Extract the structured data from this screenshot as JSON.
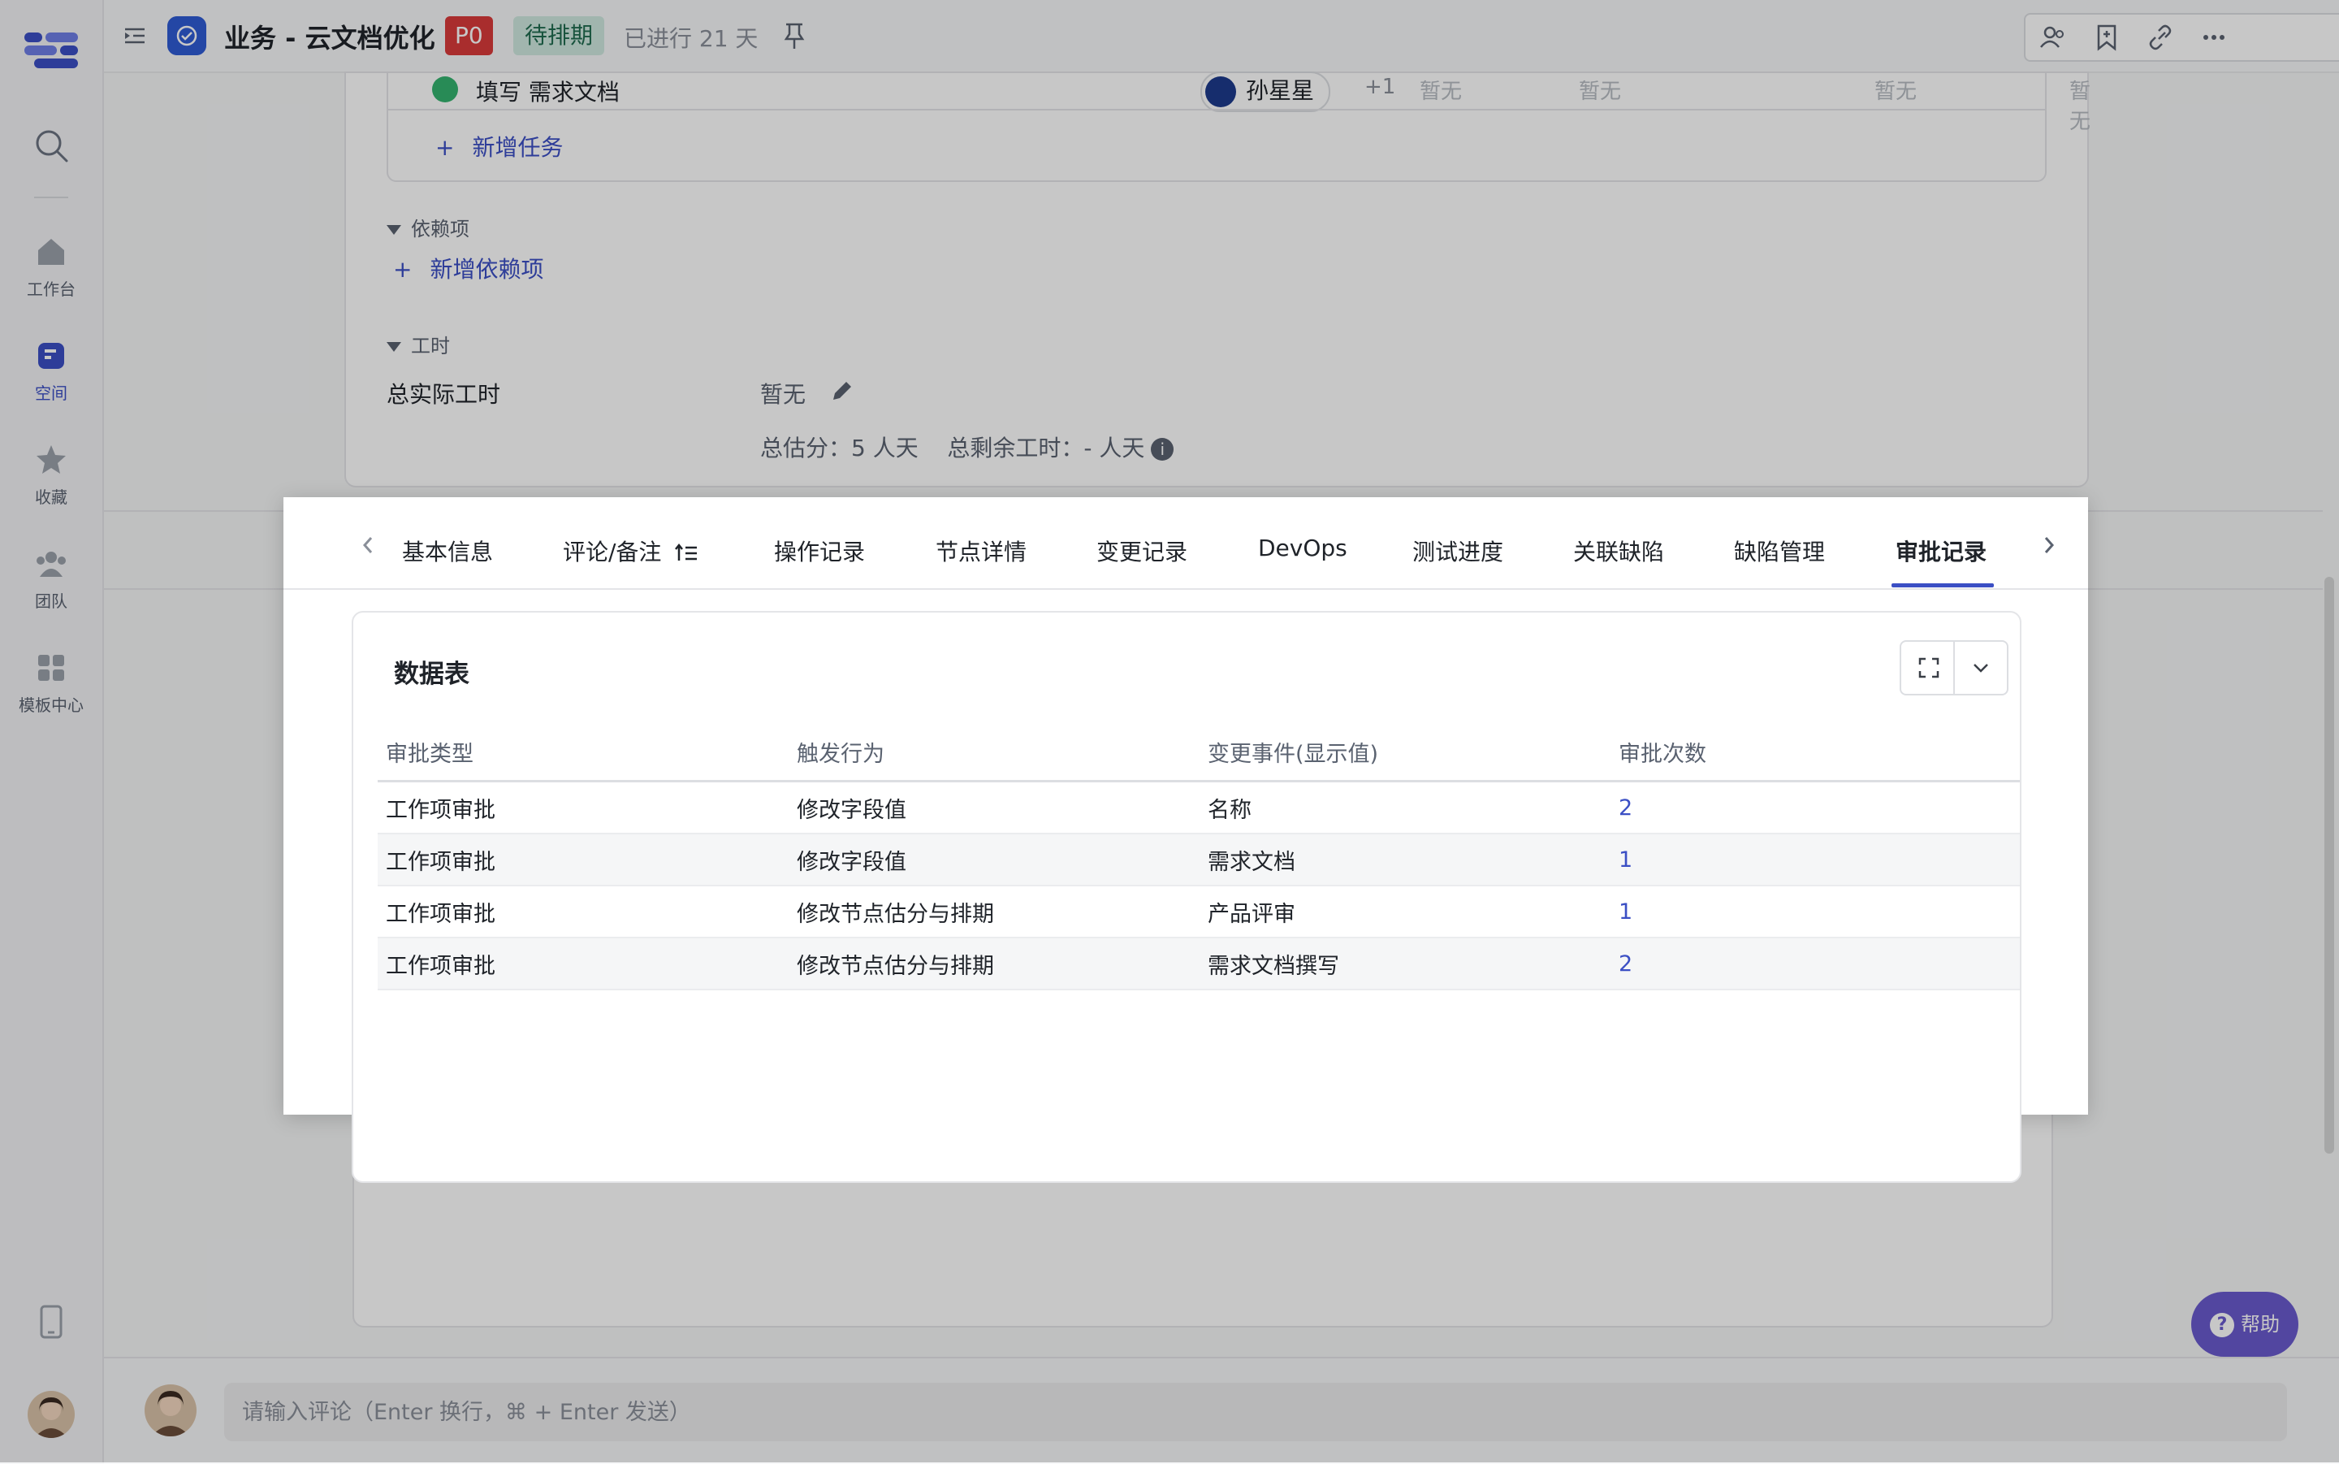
{
  "sidebar": {
    "items": [
      {
        "label": "工作台",
        "icon": "home-icon",
        "active": false
      },
      {
        "label": "空间",
        "icon": "space-icon",
        "active": true
      },
      {
        "label": "收藏",
        "icon": "star-icon",
        "active": false
      },
      {
        "label": "团队",
        "icon": "team-icon",
        "active": false
      },
      {
        "label": "模板中心",
        "icon": "template-icon",
        "active": false
      }
    ]
  },
  "header": {
    "title": "业务 - 云文档优化",
    "priority": "P0",
    "status": "待排期",
    "elapsed": "已进行 21 天"
  },
  "task": {
    "name": "填写 需求文档",
    "owner": "孙星星",
    "extra_owners": "+1",
    "placeholder_value": "暂无",
    "add_task_label": "新增任务"
  },
  "dependencies": {
    "section_label": "依赖项",
    "add_label": "新增依赖项"
  },
  "work_hours": {
    "section_label": "工时",
    "total_label": "总实际工时",
    "total_value": "暂无",
    "summary": "总估分：5 人天    总剩余工时：- 人天"
  },
  "modal": {
    "tabs": [
      {
        "label": "基本信息"
      },
      {
        "label": "评论/备注"
      },
      {
        "label": "操作记录"
      },
      {
        "label": "节点详情"
      },
      {
        "label": "变更记录"
      },
      {
        "label": "DevOps"
      },
      {
        "label": "测试进度"
      },
      {
        "label": "关联缺陷"
      },
      {
        "label": "缺陷管理"
      },
      {
        "label": "审批记录",
        "active": true
      }
    ],
    "panel_title": "数据表",
    "table": {
      "headers": [
        "审批类型",
        "触发行为",
        "变更事件(显示值)",
        "审批次数"
      ],
      "rows": [
        [
          "工作项审批",
          "修改字段值",
          "名称",
          "2"
        ],
        [
          "工作项审批",
          "修改字段值",
          "需求文档",
          "1"
        ],
        [
          "工作项审批",
          "修改节点估分与排期",
          "产品评审",
          "1"
        ],
        [
          "工作项审批",
          "修改节点估分与排期",
          "需求文档撰写",
          "2"
        ]
      ]
    }
  },
  "comment": {
    "placeholder": "请输入评论（Enter 换行，⌘ + Enter 发送）"
  },
  "help": {
    "label": "帮助"
  },
  "colors": {
    "accent": "#3b4fc4",
    "priority": "#d93a3a",
    "status_bg": "#cfe8df",
    "help": "#6a5acd"
  }
}
